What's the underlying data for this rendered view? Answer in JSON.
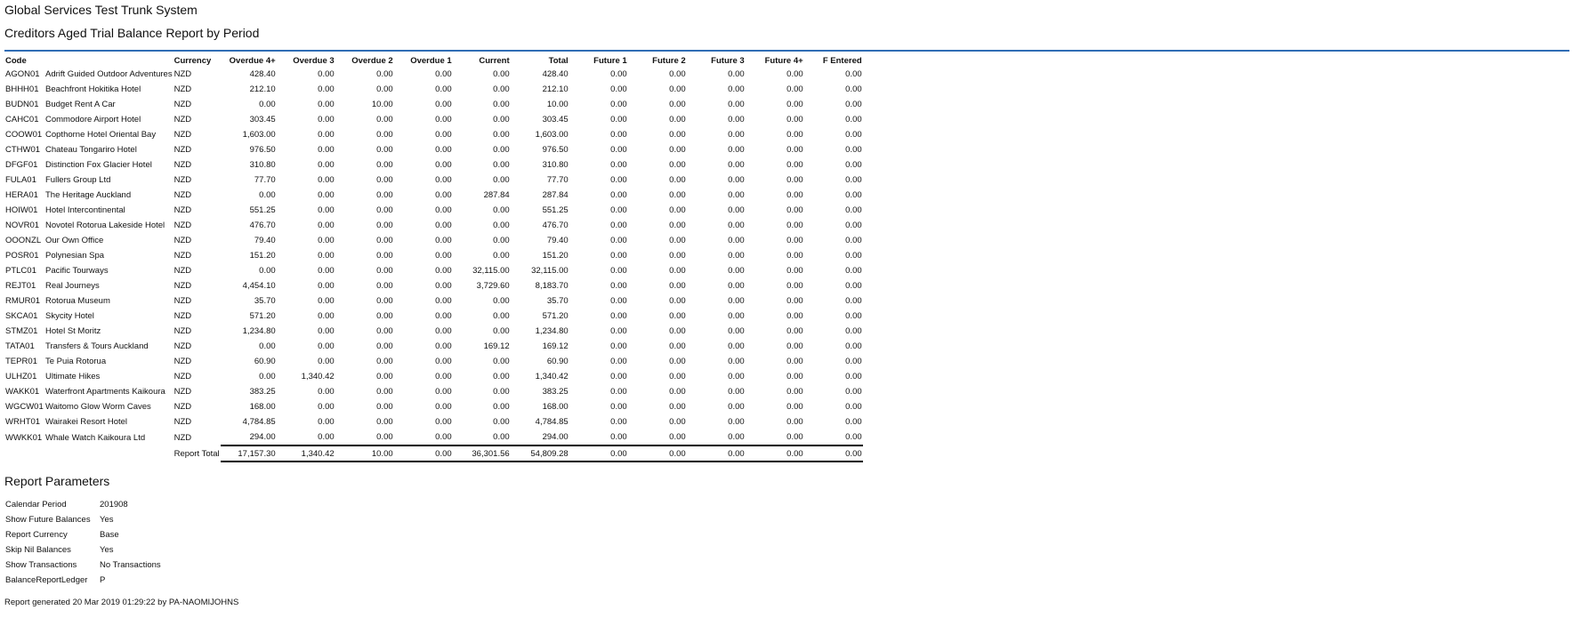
{
  "header": {
    "app_title": "Global Services Test Trunk System",
    "report_title": "Creditors Aged Trial Balance Report by Period",
    "rule_color": "#2f6db5"
  },
  "table": {
    "columns": [
      "Code",
      "",
      "Currency",
      "Overdue 4+",
      "Overdue 3",
      "Overdue 2",
      "Overdue 1",
      "Current",
      "Total",
      "Future 1",
      "Future 2",
      "Future 3",
      "Future 4+",
      "F Entered"
    ],
    "rows": [
      [
        "AGON01",
        "Adrift Guided Outdoor Adventures",
        "NZD",
        "428.40",
        "0.00",
        "0.00",
        "0.00",
        "0.00",
        "428.40",
        "0.00",
        "0.00",
        "0.00",
        "0.00",
        "0.00"
      ],
      [
        "BHHH01",
        "Beachfront Hokitika Hotel",
        "NZD",
        "212.10",
        "0.00",
        "0.00",
        "0.00",
        "0.00",
        "212.10",
        "0.00",
        "0.00",
        "0.00",
        "0.00",
        "0.00"
      ],
      [
        "BUDN01",
        "Budget Rent A Car",
        "NZD",
        "0.00",
        "0.00",
        "10.00",
        "0.00",
        "0.00",
        "10.00",
        "0.00",
        "0.00",
        "0.00",
        "0.00",
        "0.00"
      ],
      [
        "CAHC01",
        "Commodore Airport Hotel",
        "NZD",
        "303.45",
        "0.00",
        "0.00",
        "0.00",
        "0.00",
        "303.45",
        "0.00",
        "0.00",
        "0.00",
        "0.00",
        "0.00"
      ],
      [
        "COOW01",
        "Copthorne Hotel Oriental Bay",
        "NZD",
        "1,603.00",
        "0.00",
        "0.00",
        "0.00",
        "0.00",
        "1,603.00",
        "0.00",
        "0.00",
        "0.00",
        "0.00",
        "0.00"
      ],
      [
        "CTHW01",
        "Chateau Tongariro Hotel",
        "NZD",
        "976.50",
        "0.00",
        "0.00",
        "0.00",
        "0.00",
        "976.50",
        "0.00",
        "0.00",
        "0.00",
        "0.00",
        "0.00"
      ],
      [
        "DFGF01",
        "Distinction Fox Glacier Hotel",
        "NZD",
        "310.80",
        "0.00",
        "0.00",
        "0.00",
        "0.00",
        "310.80",
        "0.00",
        "0.00",
        "0.00",
        "0.00",
        "0.00"
      ],
      [
        "FULA01",
        "Fullers Group Ltd",
        "NZD",
        "77.70",
        "0.00",
        "0.00",
        "0.00",
        "0.00",
        "77.70",
        "0.00",
        "0.00",
        "0.00",
        "0.00",
        "0.00"
      ],
      [
        "HERA01",
        "The Heritage Auckland",
        "NZD",
        "0.00",
        "0.00",
        "0.00",
        "0.00",
        "287.84",
        "287.84",
        "0.00",
        "0.00",
        "0.00",
        "0.00",
        "0.00"
      ],
      [
        "HOIW01",
        "Hotel Intercontinental",
        "NZD",
        "551.25",
        "0.00",
        "0.00",
        "0.00",
        "0.00",
        "551.25",
        "0.00",
        "0.00",
        "0.00",
        "0.00",
        "0.00"
      ],
      [
        "NOVR01",
        "Novotel Rotorua Lakeside Hotel",
        "NZD",
        "476.70",
        "0.00",
        "0.00",
        "0.00",
        "0.00",
        "476.70",
        "0.00",
        "0.00",
        "0.00",
        "0.00",
        "0.00"
      ],
      [
        "OOONZL",
        "Our Own Office",
        "NZD",
        "79.40",
        "0.00",
        "0.00",
        "0.00",
        "0.00",
        "79.40",
        "0.00",
        "0.00",
        "0.00",
        "0.00",
        "0.00"
      ],
      [
        "POSR01",
        "Polynesian Spa",
        "NZD",
        "151.20",
        "0.00",
        "0.00",
        "0.00",
        "0.00",
        "151.20",
        "0.00",
        "0.00",
        "0.00",
        "0.00",
        "0.00"
      ],
      [
        "PTLC01",
        "Pacific Tourways",
        "NZD",
        "0.00",
        "0.00",
        "0.00",
        "0.00",
        "32,115.00",
        "32,115.00",
        "0.00",
        "0.00",
        "0.00",
        "0.00",
        "0.00"
      ],
      [
        "REJT01",
        "Real Journeys",
        "NZD",
        "4,454.10",
        "0.00",
        "0.00",
        "0.00",
        "3,729.60",
        "8,183.70",
        "0.00",
        "0.00",
        "0.00",
        "0.00",
        "0.00"
      ],
      [
        "RMUR01",
        "Rotorua Museum",
        "NZD",
        "35.70",
        "0.00",
        "0.00",
        "0.00",
        "0.00",
        "35.70",
        "0.00",
        "0.00",
        "0.00",
        "0.00",
        "0.00"
      ],
      [
        "SKCA01",
        "Skycity Hotel",
        "NZD",
        "571.20",
        "0.00",
        "0.00",
        "0.00",
        "0.00",
        "571.20",
        "0.00",
        "0.00",
        "0.00",
        "0.00",
        "0.00"
      ],
      [
        "STMZ01",
        "Hotel St Moritz",
        "NZD",
        "1,234.80",
        "0.00",
        "0.00",
        "0.00",
        "0.00",
        "1,234.80",
        "0.00",
        "0.00",
        "0.00",
        "0.00",
        "0.00"
      ],
      [
        "TATA01",
        "Transfers & Tours Auckland",
        "NZD",
        "0.00",
        "0.00",
        "0.00",
        "0.00",
        "169.12",
        "169.12",
        "0.00",
        "0.00",
        "0.00",
        "0.00",
        "0.00"
      ],
      [
        "TEPR01",
        "Te Puia Rotorua",
        "NZD",
        "60.90",
        "0.00",
        "0.00",
        "0.00",
        "0.00",
        "60.90",
        "0.00",
        "0.00",
        "0.00",
        "0.00",
        "0.00"
      ],
      [
        "ULHZ01",
        "Ultimate Hikes",
        "NZD",
        "0.00",
        "1,340.42",
        "0.00",
        "0.00",
        "0.00",
        "1,340.42",
        "0.00",
        "0.00",
        "0.00",
        "0.00",
        "0.00"
      ],
      [
        "WAKK01",
        "Waterfront Apartments Kaikoura",
        "NZD",
        "383.25",
        "0.00",
        "0.00",
        "0.00",
        "0.00",
        "383.25",
        "0.00",
        "0.00",
        "0.00",
        "0.00",
        "0.00"
      ],
      [
        "WGCW01",
        "Waitomo Glow Worm Caves",
        "NZD",
        "168.00",
        "0.00",
        "0.00",
        "0.00",
        "0.00",
        "168.00",
        "0.00",
        "0.00",
        "0.00",
        "0.00",
        "0.00"
      ],
      [
        "WRHT01",
        "Wairakei Resort Hotel",
        "NZD",
        "4,784.85",
        "0.00",
        "0.00",
        "0.00",
        "0.00",
        "4,784.85",
        "0.00",
        "0.00",
        "0.00",
        "0.00",
        "0.00"
      ],
      [
        "WWKK01",
        "Whale Watch Kaikoura Ltd",
        "NZD",
        "294.00",
        "0.00",
        "0.00",
        "0.00",
        "0.00",
        "294.00",
        "0.00",
        "0.00",
        "0.00",
        "0.00",
        "0.00"
      ]
    ],
    "total_label": "Report Total",
    "totals": [
      "17,157.30",
      "1,340.42",
      "10.00",
      "0.00",
      "36,301.56",
      "54,809.28",
      "0.00",
      "0.00",
      "0.00",
      "0.00",
      "0.00"
    ]
  },
  "params": {
    "title": "Report Parameters",
    "items": [
      {
        "label": "Calendar Period",
        "value": "201908"
      },
      {
        "label": "Show Future Balances",
        "value": "Yes"
      },
      {
        "label": "Report Currency",
        "value": "Base"
      },
      {
        "label": "Skip Nil Balances",
        "value": "Yes"
      },
      {
        "label": "Show Transactions",
        "value": "No Transactions"
      },
      {
        "label": "BalanceReportLedger",
        "value": "P"
      }
    ]
  },
  "footer": {
    "generated": "Report generated 20 Mar 2019 01:29:22 by PA-NAOMIJOHNS"
  }
}
